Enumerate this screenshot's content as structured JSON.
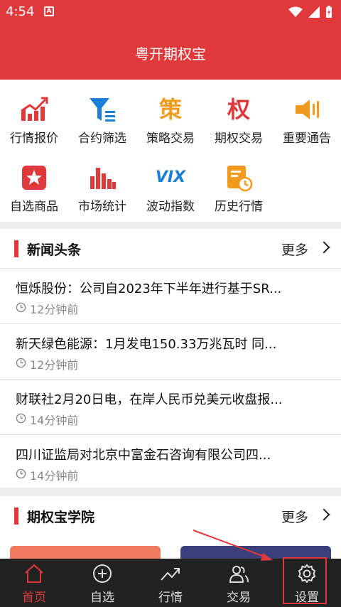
{
  "status_bar": {
    "time": "4:54",
    "notif": "A"
  },
  "header": {
    "title": "粤开期权宝"
  },
  "grid": [
    {
      "label": "行情报价",
      "icon": "market-quote-icon"
    },
    {
      "label": "合约筛选",
      "icon": "filter-icon"
    },
    {
      "label": "策略交易",
      "icon": "strategy-icon",
      "glyph": "策"
    },
    {
      "label": "期权交易",
      "icon": "option-trade-icon",
      "glyph": "权"
    },
    {
      "label": "重要通告",
      "icon": "announcement-icon"
    },
    {
      "label": "自选商品",
      "icon": "favorite-star-icon"
    },
    {
      "label": "市场统计",
      "icon": "bar-chart-icon"
    },
    {
      "label": "波动指数",
      "icon": "vix-icon",
      "glyph": "VIX"
    },
    {
      "label": "历史行情",
      "icon": "history-icon"
    }
  ],
  "news": {
    "title": "新闻头条",
    "more": "更多",
    "items": [
      {
        "title": "恒烁股份：公司自2023年下半年进行基于SR...",
        "time": "12分钟前"
      },
      {
        "title": "新天绿色能源：1月发电150.33万兆瓦时 同...",
        "time": "12分钟前"
      },
      {
        "title": "财联社2月20日电，在岸人民币兑美元收盘报...",
        "time": "14分钟前"
      },
      {
        "title": "四川证监局对北京中富金石咨询有限公司四...",
        "time": "14分钟前"
      }
    ]
  },
  "academy": {
    "title": "期权宝学院",
    "more": "更多"
  },
  "tabs": [
    {
      "label": "首页",
      "icon": "home-icon",
      "active": true
    },
    {
      "label": "自选",
      "icon": "add-circle-icon"
    },
    {
      "label": "行情",
      "icon": "trend-icon"
    },
    {
      "label": "交易",
      "icon": "users-icon"
    },
    {
      "label": "设置",
      "icon": "gear-icon"
    }
  ],
  "colors": {
    "brand": "#e0393b",
    "tabbar": "#222222"
  }
}
